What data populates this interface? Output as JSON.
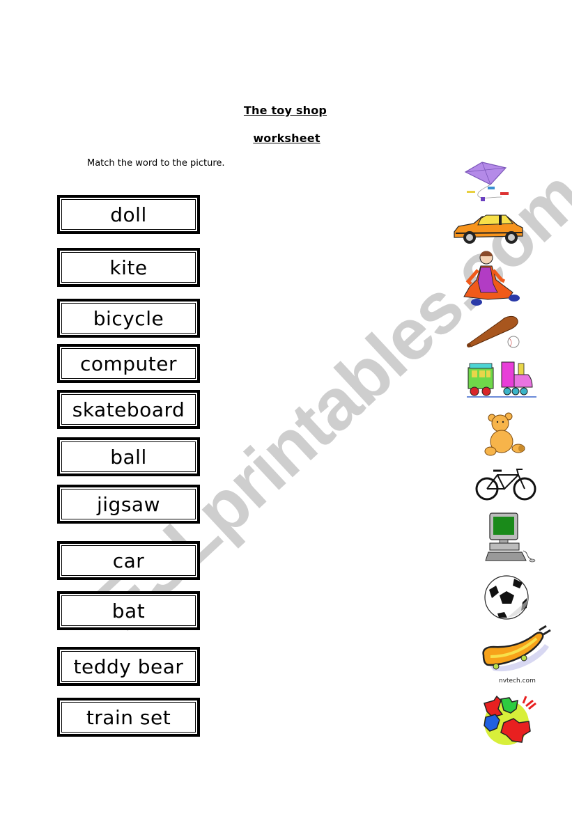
{
  "header": {
    "title": "The toy shop",
    "subtitle": "worksheet",
    "instruction": "Match the word to the picture."
  },
  "words": [
    {
      "label": "doll"
    },
    {
      "label": "kite"
    },
    {
      "label": "bicycle"
    },
    {
      "label": "computer"
    },
    {
      "label": "skateboard"
    },
    {
      "label": "ball"
    },
    {
      "label": "jigsaw"
    },
    {
      "label": "car"
    },
    {
      "label": "bat"
    },
    {
      "label": "teddy bear"
    },
    {
      "label": "train set"
    }
  ],
  "pictures": [
    {
      "icon": "kite-icon"
    },
    {
      "icon": "car-icon"
    },
    {
      "icon": "doll-icon"
    },
    {
      "icon": "bat-icon"
    },
    {
      "icon": "train-set-icon"
    },
    {
      "icon": "teddy-bear-icon"
    },
    {
      "icon": "bicycle-icon"
    },
    {
      "icon": "computer-icon"
    },
    {
      "icon": "ball-icon"
    },
    {
      "icon": "skateboard-icon"
    },
    {
      "icon": "jigsaw-icon"
    }
  ],
  "image_credit": "nvtech.com",
  "watermark": "ESLprintables.com"
}
